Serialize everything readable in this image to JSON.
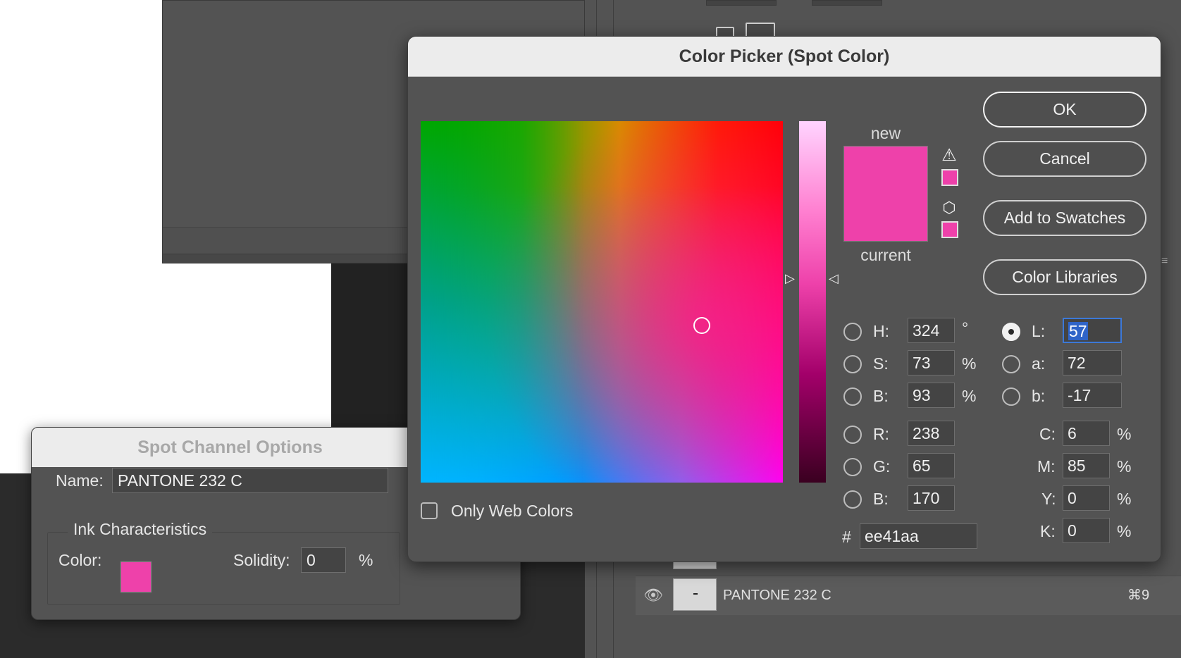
{
  "background": {
    "layer": {
      "name": "PANTONE 232 C",
      "shortcut": "⌘9",
      "eye_icon": "eye-icon"
    }
  },
  "spot_channel_options": {
    "title": "Spot Channel Options",
    "name_label": "Name:",
    "name_value": "PANTONE 232 C",
    "group_label": "Ink Characteristics",
    "color_label": "Color:",
    "solidity_label": "Solidity:",
    "solidity_value": "0",
    "solidity_unit": "%",
    "color_hex": "#ee41aa"
  },
  "color_picker": {
    "title": "Color Picker (Spot Color)",
    "new_label": "new",
    "current_label": "current",
    "buttons": {
      "ok": "OK",
      "cancel": "Cancel",
      "add_to_swatches": "Add to Swatches",
      "color_libraries": "Color Libraries"
    },
    "hsb": [
      {
        "label": "H:",
        "value": "324",
        "unit": "°"
      },
      {
        "label": "S:",
        "value": "73",
        "unit": "%"
      },
      {
        "label": "B:",
        "value": "93",
        "unit": "%"
      }
    ],
    "rgb": [
      {
        "label": "R:",
        "value": "238"
      },
      {
        "label": "G:",
        "value": "65"
      },
      {
        "label": "B:",
        "value": "170"
      }
    ],
    "lab": [
      {
        "label": "L:",
        "value": "57"
      },
      {
        "label": "a:",
        "value": "72"
      },
      {
        "label": "b:",
        "value": "-17"
      }
    ],
    "cmyk": [
      {
        "label": "C:",
        "value": "6",
        "unit": "%"
      },
      {
        "label": "M:",
        "value": "85",
        "unit": "%"
      },
      {
        "label": "Y:",
        "value": "0",
        "unit": "%"
      },
      {
        "label": "K:",
        "value": "0",
        "unit": "%"
      }
    ],
    "hex_label": "#",
    "hex_value": "ee41aa",
    "only_web_colors_label": "Only Web Colors",
    "selected_radio": "L",
    "colors": {
      "new": "#ee41aa",
      "current": "#ee41aa",
      "web_safe": "#ee41aa",
      "gamut": "#ee41aa"
    }
  }
}
